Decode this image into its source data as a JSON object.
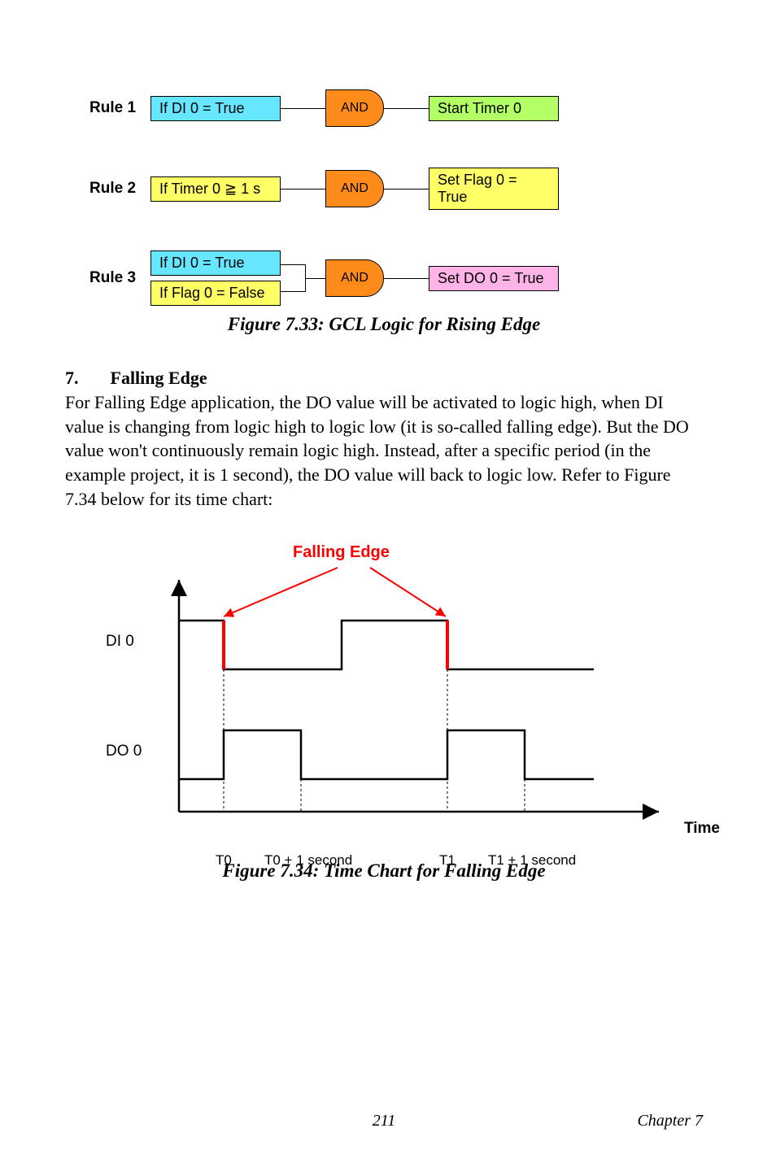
{
  "rules": {
    "r1": {
      "label": "Rule 1",
      "cond": "If DI 0 = True",
      "gate": "AND",
      "out": "Start Timer 0"
    },
    "r2": {
      "label": "Rule 2",
      "cond": "If Timer 0 ≧ 1 s",
      "gate": "AND",
      "out": "Set Flag 0 = True"
    },
    "r3": {
      "label": "Rule 3",
      "cond1": "If DI 0 = True",
      "cond2": "If Flag 0 = False",
      "gate": "AND",
      "out": "Set DO 0 = True"
    }
  },
  "fig1_caption": "Figure 7.33: GCL Logic for Rising Edge",
  "section": {
    "num": "7.",
    "title": "Falling Edge",
    "body": "For Falling Edge application, the DO value will be activated to logic high, when DI value is changing from logic high to logic low (it is so-called falling edge). But the DO value won't continuously remain logic high. Instead, after a specific period (in the example project, it is 1 second), the DO value will back to logic low. Refer to Figure 7.34 below for its time chart:"
  },
  "chart": {
    "falling_label": "Falling Edge",
    "y1": "DI 0",
    "y2": "DO 0",
    "time_label": "Time",
    "ticks": {
      "t0": "T0",
      "t1": "T0 + 1 second",
      "t2": "T1",
      "t3": "T1 + 1 second"
    }
  },
  "fig2_caption": "Figure 7.34: Time Chart for Falling Edge",
  "footer": {
    "page": "211",
    "chapter": "Chapter 7"
  },
  "chart_data": {
    "type": "line",
    "title": "Time Chart for Falling Edge",
    "xlabel": "Time",
    "x_ticks": [
      "T0",
      "T0 + 1 second",
      "T1",
      "T1 + 1 second"
    ],
    "series": [
      {
        "name": "DI 0",
        "segments": [
          {
            "from": "start",
            "to": "T0",
            "level": 1
          },
          {
            "from": "T0",
            "to": "mid",
            "level": 0
          },
          {
            "from": "mid",
            "to": "T1",
            "level": 1
          },
          {
            "from": "T1",
            "to": "end",
            "level": 0
          }
        ]
      },
      {
        "name": "DO 0",
        "segments": [
          {
            "from": "start",
            "to": "T0",
            "level": 0
          },
          {
            "from": "T0",
            "to": "T0 + 1 second",
            "level": 1
          },
          {
            "from": "T0 + 1 second",
            "to": "T1",
            "level": 0
          },
          {
            "from": "T1",
            "to": "T1 + 1 second",
            "level": 1
          },
          {
            "from": "T1 + 1 second",
            "to": "end",
            "level": 0
          }
        ]
      }
    ],
    "annotations": [
      "Falling Edge arrows point to T0 and T1 on DI 0"
    ]
  }
}
